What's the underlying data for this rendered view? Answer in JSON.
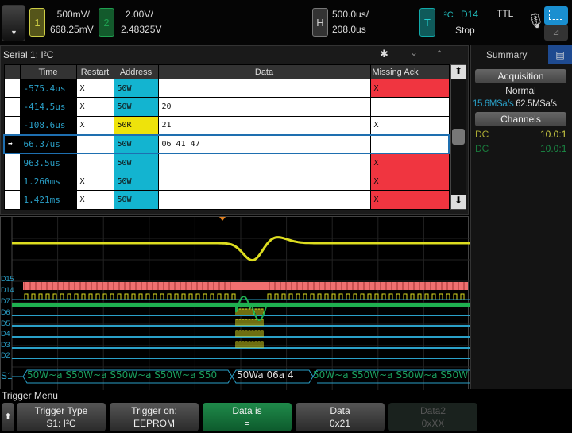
{
  "topbar": {
    "ch1": {
      "num": "1",
      "scale": "500mV/",
      "offset": "668.25mV",
      "color": "#c8c840"
    },
    "ch2": {
      "num": "2",
      "scale": "2.00V/",
      "offset": "2.48325V",
      "color": "#1fa050"
    },
    "horizontal": {
      "label": "H",
      "scale": "500.0us/",
      "delay": "208.0us"
    },
    "trigger": {
      "label": "T",
      "type": "I²C",
      "source": "D14",
      "level": "TTL",
      "status": "Stop"
    }
  },
  "serial": {
    "title": "Serial 1: I²C",
    "columns": [
      "Time",
      "Restart",
      "Address",
      "Data",
      "Missing Ack"
    ],
    "rows": [
      {
        "time": "-575.4us",
        "restart": "X",
        "address": "50W",
        "data": "",
        "ack": "X",
        "addr_type": "w",
        "ack_err": true
      },
      {
        "time": "-414.5us",
        "restart": "X",
        "address": "50W",
        "data": "20",
        "ack": "",
        "addr_type": "w",
        "ack_err": false
      },
      {
        "time": "-108.6us",
        "restart": "X",
        "address": "50R",
        "data": "21",
        "ack": "X",
        "addr_type": "r",
        "ack_err": false
      },
      {
        "time": "66.37us",
        "restart": "",
        "address": "50W",
        "data": "06 41 47",
        "ack": "",
        "addr_type": "w",
        "ack_err": false,
        "selected": true
      },
      {
        "time": "963.5us",
        "restart": "",
        "address": "50W",
        "data": "",
        "ack": "X",
        "addr_type": "w",
        "ack_err": true
      },
      {
        "time": "1.260ms",
        "restart": "X",
        "address": "50W",
        "data": "",
        "ack": "X",
        "addr_type": "w",
        "ack_err": true
      },
      {
        "time": "1.421ms",
        "restart": "X",
        "address": "50W",
        "data": "",
        "ack": "X",
        "addr_type": "w",
        "ack_err": true
      }
    ]
  },
  "sidebar": {
    "tab": "Summary",
    "acquisition": "Acquisition",
    "mode": "Normal",
    "rate1": "15.6MSa/s",
    "rate2": "62.5MSa/s",
    "channels": "Channels",
    "ch1": {
      "coupling": "DC",
      "probe": "10.0:1"
    },
    "ch2": {
      "coupling": "DC",
      "probe": "10.0:1"
    }
  },
  "waveform": {
    "channels": [
      "D15",
      "D14",
      "D7",
      "D6",
      "D5",
      "D4",
      "D3",
      "D2"
    ],
    "bus_label": "S1",
    "bus_segments": [
      "50W~a S50W~a S50W~a S50W~a S50",
      "50Wa 06a 4",
      "50W~a S50W~a S50W~a S50W"
    ]
  },
  "trigger_menu": {
    "title": "Trigger Menu",
    "keys": [
      {
        "label": "Trigger Type",
        "value": "S1: I²C"
      },
      {
        "label": "Trigger on:",
        "value": "EEPROM"
      },
      {
        "label": "Data is",
        "value": "="
      },
      {
        "label": "Data",
        "value": "0x21"
      },
      {
        "label": "Data2",
        "value": "0xXX"
      }
    ]
  }
}
